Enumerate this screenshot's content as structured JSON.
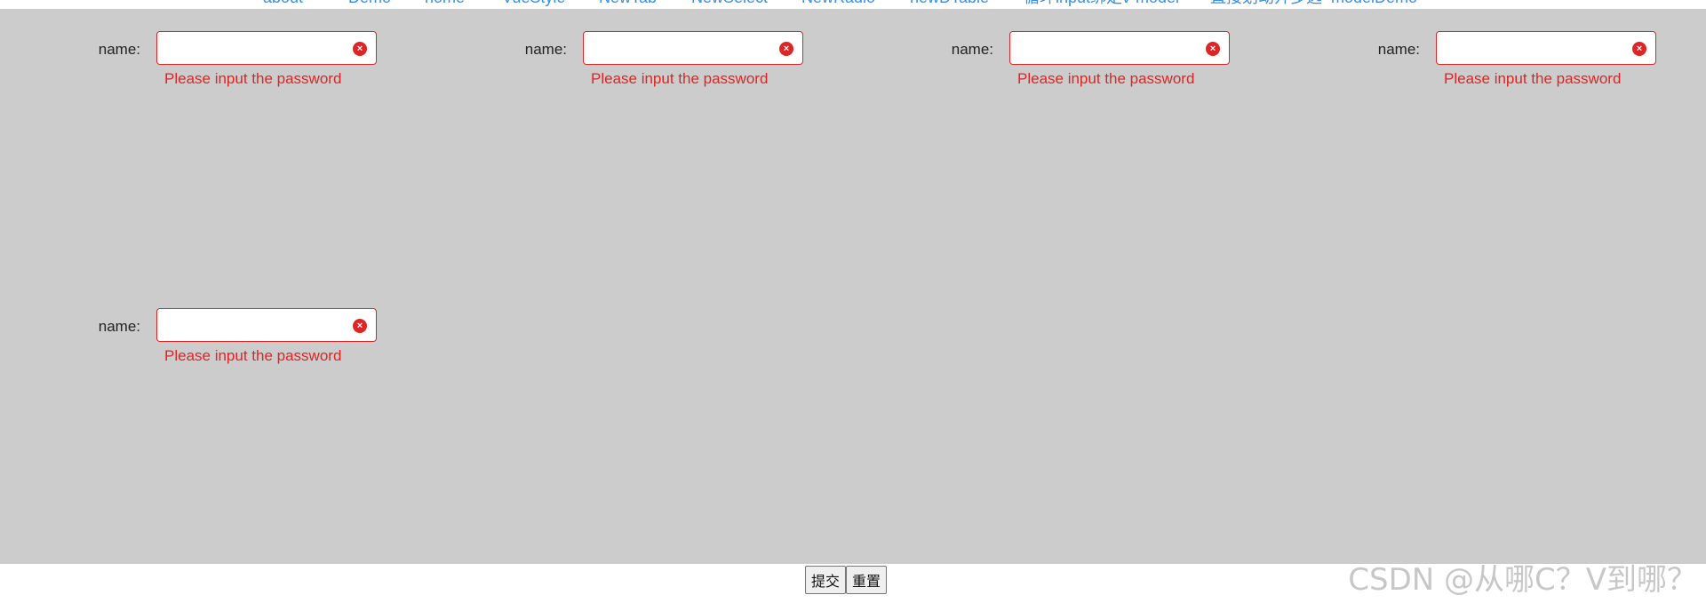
{
  "nav": {
    "items": [
      "about",
      "Demo",
      "home",
      "VueStyle",
      "NewTab",
      "NewSelect",
      "NewRadio",
      "newDTable",
      "循环input绑定v-model",
      "直接划动开多选",
      "modelDemo"
    ]
  },
  "form": {
    "fields": [
      {
        "label": "name:",
        "value": "",
        "error": "Please input the password"
      },
      {
        "label": "name:",
        "value": "",
        "error": "Please input the password"
      },
      {
        "label": "name:",
        "value": "",
        "error": "Please input the password"
      },
      {
        "label": "name:",
        "value": "",
        "error": "Please input the password"
      },
      {
        "label": "name:",
        "value": "",
        "error": "Please input the password"
      }
    ],
    "clear_glyph": "×"
  },
  "actions": {
    "submit_label": "提交",
    "reset_label": "重置"
  },
  "watermark": "CSDN @从哪C？V到哪？",
  "colors": {
    "background": "#cccccc",
    "error": "#e02424",
    "link": "#3a8ee6"
  }
}
